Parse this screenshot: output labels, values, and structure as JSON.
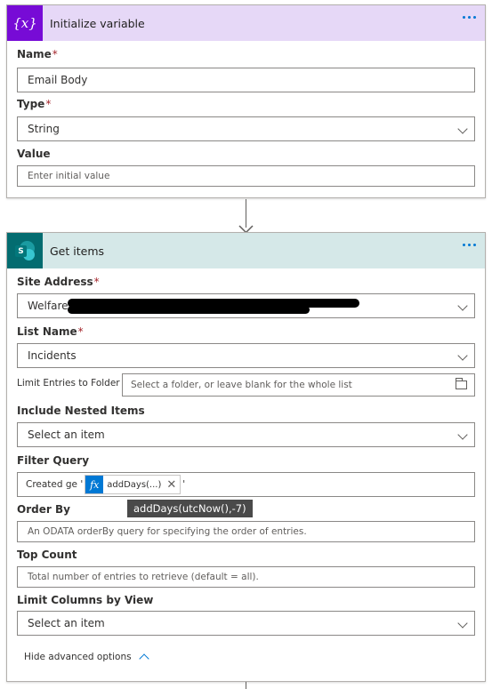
{
  "init_card": {
    "title": "Initialize variable",
    "icon_text": "{x}",
    "name_label": "Name",
    "name_value": "Email Body",
    "type_label": "Type",
    "type_value": "String",
    "value_label": "Value",
    "value_placeholder": "Enter initial value"
  },
  "get_items_card": {
    "title": "Get items",
    "icon_text": "S",
    "site_address_label": "Site Address",
    "site_address_value": "Welfare",
    "list_name_label": "List Name",
    "list_name_value": "Incidents",
    "limit_folder_label": "Limit Entries to Folder",
    "limit_folder_placeholder": "Select a folder, or leave blank for the whole list",
    "nested_label": "Include Nested Items",
    "nested_value": "Select an item",
    "filter_label": "Filter Query",
    "filter_prefix": "Created ge '",
    "filter_token": "addDays(...)",
    "filter_suffix": "'",
    "tooltip": "addDays(utcNow(),-7)",
    "order_label": "Order By",
    "order_placeholder": "An ODATA orderBy query for specifying the order of entries.",
    "top_label": "Top Count",
    "top_placeholder": "Total number of entries to retrieve (default = all).",
    "columns_label": "Limit Columns by View",
    "columns_value": "Select an item",
    "advanced_toggle": "Hide advanced options"
  },
  "colors": {
    "init_header_bg": "#e6d8f7",
    "init_icon_bg": "#770bd6",
    "getitems_header_bg": "#d5e8e8",
    "getitems_icon_bg": "#036c70",
    "accent": "#0078d4",
    "token_bg": "#0078d4"
  }
}
